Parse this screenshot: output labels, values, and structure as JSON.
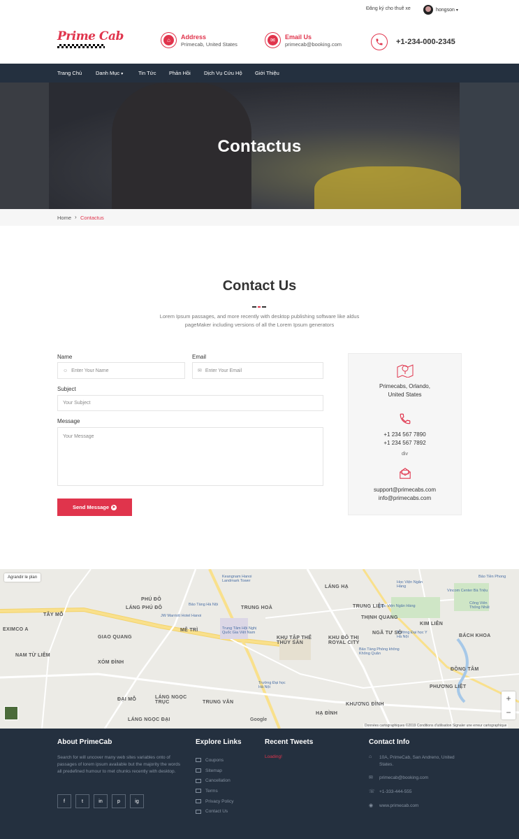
{
  "topbar": {
    "register": "Đăng ký cho thuê xe",
    "username": "hongson"
  },
  "header": {
    "logo": "Prime Cab",
    "address_title": "Address",
    "address_value": "Primecab, United States",
    "email_title": "Email Us",
    "email_value": "primecab@booking.com",
    "phone": "+1-234-000-2345"
  },
  "nav": {
    "items": [
      "Trang Chủ",
      "Danh Mục",
      "Tin Tức",
      "Phản Hồi",
      "Dịch Vụ Cứu Hộ",
      "Giới Thiệu"
    ]
  },
  "hero": {
    "title": "Contactus"
  },
  "breadcrumb": {
    "home": "Home",
    "current": "Contactus"
  },
  "contact": {
    "title": "Contact Us",
    "description": "Lorem Ipsum passages, and more recently with desktop publishing software like aldus pageMaker including versions of all the Lorem Ipsum generators",
    "name_label": "Name",
    "name_placeholder": "Enter Your Name",
    "email_label": "Email",
    "email_placeholder": "Enter Your Email",
    "subject_label": "Subject",
    "subject_placeholder": "Your Subject",
    "message_label": "Message",
    "message_placeholder": "Your Message",
    "send_label": "Send Message"
  },
  "info": {
    "address_line1": "Primecabs, Orlando,",
    "address_line2": "United States",
    "phone1": "+1 234 567 7890",
    "phone2": "+1 234 567 7892",
    "div_text": "div",
    "email1": "support@primecabs.com",
    "email2": "info@primecabs.com"
  },
  "map": {
    "enlarge": "Agrandir le plan",
    "attribution": "Données cartographiques ©2019   Conditions d'utilisation   Signaler une erreur cartographique",
    "google": "Google",
    "labels": [
      "TRUNG HOÀ",
      "TRUNG LIỆT",
      "LÁNG PHÚ ĐÔ",
      "PHÚ ĐÔ",
      "MỄ TRÌ",
      "GIAO QUANG",
      "NAM TỪ LIÊM",
      "XÓM ĐÌNH",
      "TÂY MỖ",
      "ĐẠI MỖ",
      "LÁNG NGỌC TRỤC",
      "TRUNG VĂN",
      "LÁNG NGỌC ĐẠI",
      "KHU TẬP THỂ THỦY SẢN",
      "KHU ĐÔ THỊ ROYAL CITY",
      "NGÃ TƯ SỞ",
      "KIM LIÊN",
      "BÁCH KHOA",
      "ĐỒNG TÂM",
      "PHƯƠNG LIỆT",
      "KHƯƠNG ĐÌNH",
      "HẠ ĐÌNH",
      "THỊNH QUANG",
      "LÁNG HẠ",
      "EXIMCO A"
    ],
    "small_labels": [
      "Keangnam Hanoi Landmark Tower",
      "Bảo Tàng Hà Nội",
      "JW Marriott Hotel Hanoi",
      "Trung Tâm Hội Nghị Quốc Gia Việt Nam",
      "Trường Đại học Hà Nội",
      "Học Viện Ngân Hàng",
      "Bảo Tàng Phòng không Không Quân",
      "Học Viện Ngân Hàng",
      "Vincom Center Bà Triệu",
      "Trường Đại học Y Hà Nội",
      "Công Viên Thống Nhất",
      "Bảo Tiền Phong"
    ]
  },
  "footer": {
    "about_title": "About PrimeCab",
    "about_text": "Search for will uncover many web sites variables onto of passages of lorem ipsum available but the majority the words all predefined humour to met chunks recently with desktop.",
    "socials": [
      "f",
      "t",
      "in",
      "p",
      "ig"
    ],
    "links_title": "Explore Links",
    "links": [
      "Coupons",
      "Sitemap",
      "Cancellation",
      "Terms",
      "Privacy Policy",
      "Contact Us"
    ],
    "tweets_title": "Recent Tweets",
    "tweets_loading": "Loading!",
    "contact_title": "Contact Info",
    "contact_address": "10A, PrimeCab, San Andreno, United States.",
    "contact_email": "primecab@booking.com",
    "contact_phone": "+1-333-444-555",
    "contact_web": "www.primecab.com"
  },
  "colors": {
    "accent": "#e0344c",
    "navy": "#24303f"
  }
}
